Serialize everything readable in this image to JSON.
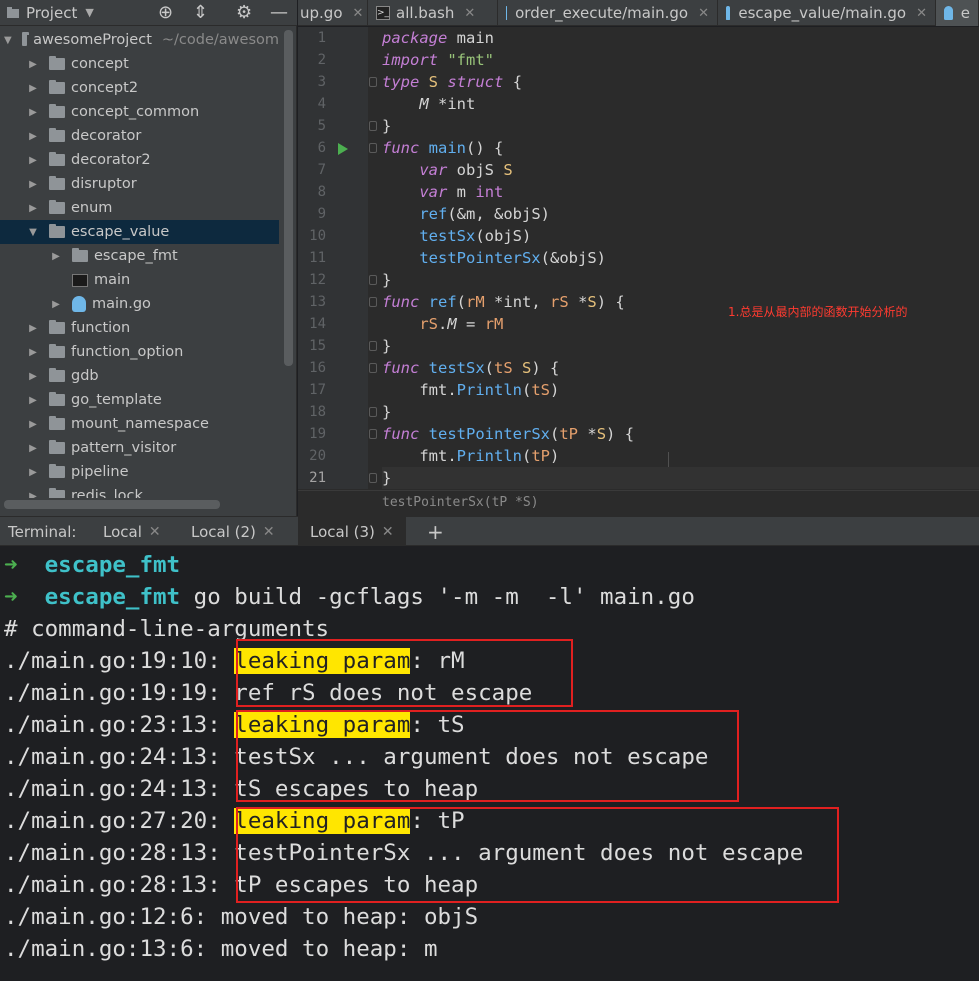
{
  "project_panel": {
    "title": "Project",
    "tree": [
      {
        "label": "awesomeProject",
        "path": "~/code/awesom",
        "kind": "folder",
        "expanded": true,
        "depth": 0
      },
      {
        "label": "concept",
        "kind": "folder",
        "depth": 1
      },
      {
        "label": "concept2",
        "kind": "folder",
        "depth": 1
      },
      {
        "label": "concept_common",
        "kind": "folder",
        "depth": 1
      },
      {
        "label": "decorator",
        "kind": "folder",
        "depth": 1
      },
      {
        "label": "decorator2",
        "kind": "folder",
        "depth": 1
      },
      {
        "label": "disruptor",
        "kind": "folder",
        "depth": 1
      },
      {
        "label": "enum",
        "kind": "folder",
        "depth": 1
      },
      {
        "label": "escape_value",
        "kind": "folder",
        "expanded": true,
        "selected": true,
        "depth": 1
      },
      {
        "label": "escape_fmt",
        "kind": "folder",
        "depth": 2
      },
      {
        "label": "main",
        "kind": "executable",
        "depth": 2
      },
      {
        "label": "main.go",
        "kind": "go-file",
        "depth": 2
      },
      {
        "label": "function",
        "kind": "folder",
        "depth": 1
      },
      {
        "label": "function_option",
        "kind": "folder",
        "depth": 1
      },
      {
        "label": "gdb",
        "kind": "folder",
        "depth": 1
      },
      {
        "label": "go_template",
        "kind": "folder",
        "depth": 1
      },
      {
        "label": "mount_namespace",
        "kind": "folder",
        "depth": 1
      },
      {
        "label": "pattern_visitor",
        "kind": "folder",
        "depth": 1
      },
      {
        "label": "pipeline",
        "kind": "folder",
        "depth": 1
      },
      {
        "label": "redis_lock",
        "kind": "folder",
        "depth": 1
      }
    ]
  },
  "editor_tabs": [
    {
      "label": "up.go",
      "icon": "go-file-icon"
    },
    {
      "label": "all.bash",
      "icon": "terminal-file-icon"
    },
    {
      "label": "order_execute/main.go",
      "icon": "go-file-icon"
    },
    {
      "label": "escape_value/main.go",
      "icon": "go-file-icon"
    },
    {
      "label": "e",
      "icon": "go-file-icon",
      "active": true
    }
  ],
  "code": {
    "line_numbers": [
      "1",
      "2",
      "3",
      "4",
      "5",
      "6",
      "7",
      "8",
      "9",
      "10",
      "11",
      "12",
      "13",
      "14",
      "15",
      "16",
      "17",
      "18",
      "19",
      "20",
      "21"
    ],
    "current_line": 21,
    "annotation": "1.总是从最内部的函数开始分析的",
    "breadcrumb": "testPointerSx(tP *S)"
  },
  "terminal_tabs": {
    "label": "Terminal:",
    "tabs": [
      "Local",
      "Local (2)",
      "Local (3)"
    ],
    "active": "Local (3)",
    "add": "+"
  },
  "terminal": {
    "prompt_dir": "escape_fmt",
    "command": "go build -gcflags '-m -m  -l' main.go",
    "header": "# command-line-arguments",
    "lines": [
      {
        "loc": "./main.go:19:10:",
        "hl": "leaking param",
        "rest": ": rM"
      },
      {
        "loc": "./main.go:19:19:",
        "hl": "",
        "rest": "ref rS does not escape"
      },
      {
        "loc": "./main.go:23:13:",
        "hl": "leaking param",
        "rest": ": tS"
      },
      {
        "loc": "./main.go:24:13:",
        "hl": "",
        "rest": "testSx ... argument does not escape"
      },
      {
        "loc": "./main.go:24:13:",
        "hl": "",
        "rest": "tS escapes to heap"
      },
      {
        "loc": "./main.go:27:20:",
        "hl": "leaking param",
        "rest": ": tP"
      },
      {
        "loc": "./main.go:28:13:",
        "hl": "",
        "rest": "testPointerSx ... argument does not escape"
      },
      {
        "loc": "./main.go:28:13:",
        "hl": "",
        "rest": "tP escapes to heap"
      },
      {
        "loc": "./main.go:12:6:",
        "hl": "",
        "rest": "moved to heap: objS"
      },
      {
        "loc": "./main.go:13:6:",
        "hl": "",
        "rest": "moved to heap: m"
      }
    ]
  },
  "colors": {
    "panel_bg": "#3c3f41",
    "editor_bg": "#2b2b2b",
    "terminal_bg": "#1e1f22",
    "highlight": "#ffe600",
    "red_box": "#e02020",
    "prompt_green": "#4caf50",
    "dir_cyan": "#3fc1c9"
  }
}
